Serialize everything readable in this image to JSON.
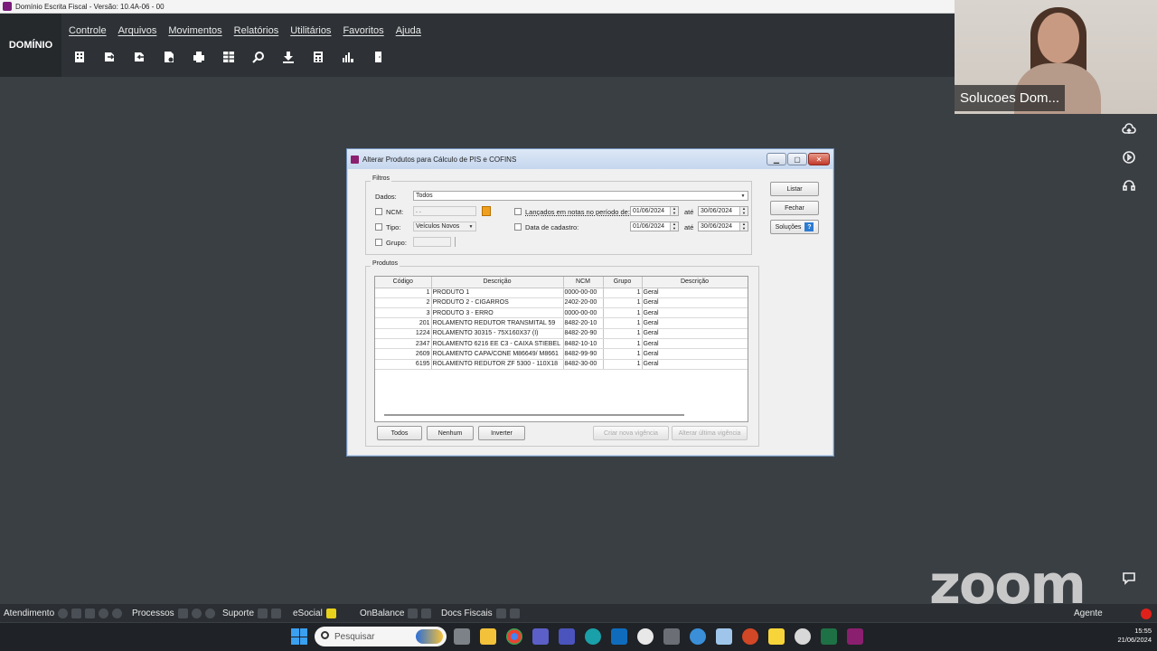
{
  "window": {
    "title": "Domínio Escrita Fiscal  - Versão: 10.4A-06 - 00"
  },
  "brand": "DOMÍNIO",
  "menu": [
    "Controle",
    "Arquivos",
    "Movimentos",
    "Relatórios",
    "Utilitários",
    "Favoritos",
    "Ajuda"
  ],
  "toolbar_icons": [
    "building-icon",
    "export-icon",
    "import-icon",
    "report-icon",
    "print-icon",
    "table-icon",
    "search-icon",
    "download-icon",
    "calculator-icon",
    "chart-icon",
    "door-icon"
  ],
  "video": {
    "participant_name": "Solucoes Dom..."
  },
  "dialog": {
    "title": "Alterar Produtos para Cálculo de PIS e COFINS",
    "filters": {
      "group_label": "Filtros",
      "dados_label": "Dados:",
      "dados_value": "Todos",
      "ncm_label": "NCM:",
      "ncm_value": ". .",
      "tipo_label": "Tipo:",
      "tipo_value": "Veículos Novos",
      "grupo_label": "Grupo:",
      "lancados_label": "Lançados em notas no período de:",
      "lancados_from": "01/06/2024",
      "lancados_to": "30/06/2024",
      "cadastro_label": "Data de cadastro:",
      "cadastro_from": "01/06/2024",
      "cadastro_to": "30/06/2024",
      "ate_label": "até"
    },
    "buttons": {
      "listar": "Listar",
      "fechar": "Fechar",
      "solucoes": "Soluções"
    },
    "products": {
      "group_label": "Produtos",
      "columns": [
        "Código",
        "Descrição",
        "NCM",
        "Grupo",
        "Descrição"
      ],
      "rows": [
        {
          "codigo": "1",
          "descricao": "PRODUTO 1",
          "ncm": "0000-00-00",
          "grupo": "1",
          "grupo_desc": "Geral"
        },
        {
          "codigo": "2",
          "descricao": "PRODUTO 2 - CIGARROS",
          "ncm": "2402-20-00",
          "grupo": "1",
          "grupo_desc": "Geral"
        },
        {
          "codigo": "3",
          "descricao": "PRODUTO 3 - ERRO",
          "ncm": "0000-00-00",
          "grupo": "1",
          "grupo_desc": "Geral"
        },
        {
          "codigo": "201",
          "descricao": "ROLAMENTO REDUTOR TRANSMITAL 59",
          "ncm": "8482-20-10",
          "grupo": "1",
          "grupo_desc": "Geral"
        },
        {
          "codigo": "1224",
          "descricao": "ROLAMENTO 30315 - 75X160X37 (I)",
          "ncm": "8482-20-90",
          "grupo": "1",
          "grupo_desc": "Geral"
        },
        {
          "codigo": "2347",
          "descricao": "ROLAMENTO 6216 EE C3 - CAIXA STIEBEL",
          "ncm": "8482-10-10",
          "grupo": "1",
          "grupo_desc": "Geral"
        },
        {
          "codigo": "2609",
          "descricao": "ROLAMENTO CAPA/CONE M86649/ M8661",
          "ncm": "8482-99-90",
          "grupo": "1",
          "grupo_desc": "Geral"
        },
        {
          "codigo": "6195",
          "descricao": "ROLAMENTO REDUTOR ZF 5300 - 110X18",
          "ncm": "8482-30-00",
          "grupo": "1",
          "grupo_desc": "Geral"
        }
      ],
      "buttons": {
        "todos": "Todos",
        "nenhum": "Nenhum",
        "inverter": "Inverter",
        "criar": "Criar nova vigência",
        "alterar": "Alterar última vigência"
      }
    }
  },
  "statusbar": [
    "Atendimento",
    "Processos",
    "Suporte",
    "eSocial",
    "OnBalance",
    "Docs Fiscais",
    "Agente"
  ],
  "zoom_logo": "zoom",
  "taskbar": {
    "search_placeholder": "Pesquisar",
    "time": "15:55",
    "date": "21/06/2024"
  },
  "colors": {
    "background": "#3a3f44",
    "header": "#2e3236",
    "dialog_title": "#c5d6ee",
    "accent": "#2d7cd1"
  }
}
